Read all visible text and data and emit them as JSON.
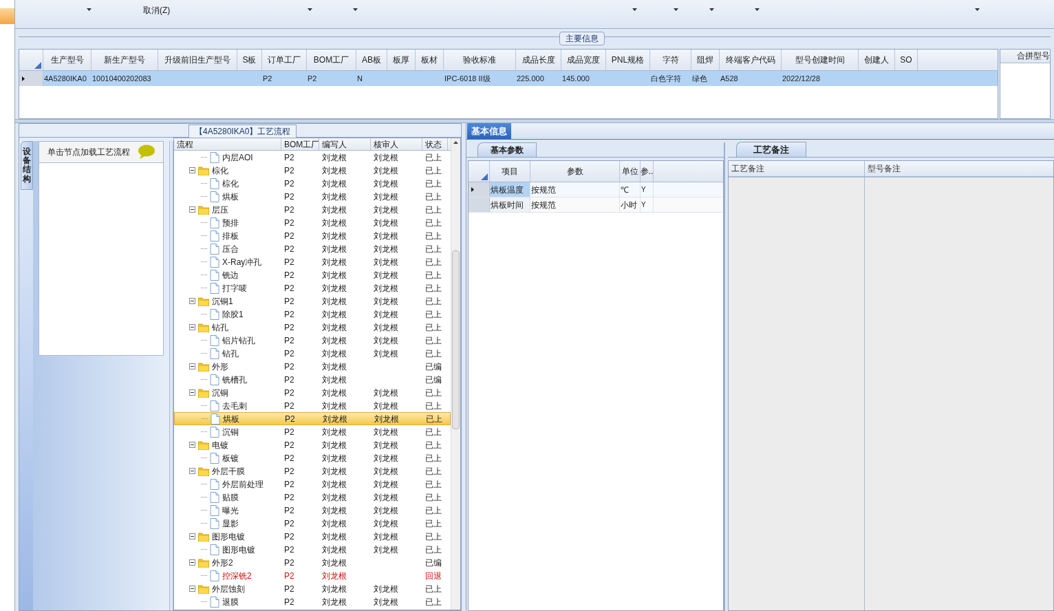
{
  "toolbar": {
    "cancel_label": "取消(Z)"
  },
  "main_info": {
    "title": "主要信息",
    "columns": [
      "生产型号",
      "新生产型号",
      "升级前旧生产型号",
      "S板",
      "订单工厂",
      "BOM工厂",
      "AB板",
      "板厚",
      "板材",
      "验收标准",
      "成品长度",
      "成品宽度",
      "PNL规格",
      "字符",
      "阻焊",
      "终端客户代码",
      "型号创建时间",
      "创建人",
      "SO"
    ],
    "rows": [
      {
        "selected": true,
        "cells": [
          "4A5280IKA0",
          "10010400202083",
          "",
          "",
          "P2",
          "P2",
          "N",
          "",
          "",
          "IPC-6018 II级",
          "225.000",
          "145.000",
          "",
          "白色字符",
          "绿色",
          "A528",
          "2022/12/28",
          "",
          ""
        ]
      }
    ],
    "side_column": "合拼型号"
  },
  "flow_panel": {
    "title": "【4A5280IKA0】工艺流程",
    "side_tab": "设备结构",
    "hint": "单击节点加载工艺流程",
    "columns": [
      "流程",
      "BOM工厂",
      "编写人",
      "核审人",
      "状态"
    ],
    "continued_children": [
      {
        "name": "内层AOI",
        "bom": "P2",
        "writer": "刘龙根",
        "reviewer": "刘龙根",
        "status": "已上",
        "selected": false,
        "returned": false
      }
    ],
    "nodes": [
      {
        "name": "棕化",
        "bom": "P2",
        "writer": "刘龙根",
        "reviewer": "刘龙根",
        "status": "已上",
        "selected": false,
        "returned": false,
        "expanded": true,
        "children": [
          {
            "name": "棕化",
            "bom": "P2",
            "writer": "刘龙根",
            "reviewer": "刘龙根",
            "status": "已上",
            "selected": false,
            "returned": false
          },
          {
            "name": "烘板",
            "bom": "P2",
            "writer": "刘龙根",
            "reviewer": "刘龙根",
            "status": "已上",
            "selected": false,
            "returned": false
          }
        ]
      },
      {
        "name": "层压",
        "bom": "P2",
        "writer": "刘龙根",
        "reviewer": "刘龙根",
        "status": "已上",
        "selected": false,
        "returned": false,
        "expanded": true,
        "children": [
          {
            "name": "预排",
            "bom": "P2",
            "writer": "刘龙根",
            "reviewer": "刘龙根",
            "status": "已上",
            "selected": false,
            "returned": false
          },
          {
            "name": "排板",
            "bom": "P2",
            "writer": "刘龙根",
            "reviewer": "刘龙根",
            "status": "已上",
            "selected": false,
            "returned": false
          },
          {
            "name": "压合",
            "bom": "P2",
            "writer": "刘龙根",
            "reviewer": "刘龙根",
            "status": "已上",
            "selected": false,
            "returned": false
          },
          {
            "name": "X-Ray冲孔",
            "bom": "P2",
            "writer": "刘龙根",
            "reviewer": "刘龙根",
            "status": "已上",
            "selected": false,
            "returned": false
          },
          {
            "name": "铣边",
            "bom": "P2",
            "writer": "刘龙根",
            "reviewer": "刘龙根",
            "status": "已上",
            "selected": false,
            "returned": false
          },
          {
            "name": "打字唛",
            "bom": "P2",
            "writer": "刘龙根",
            "reviewer": "刘龙根",
            "status": "已上",
            "selected": false,
            "returned": false
          }
        ]
      },
      {
        "name": "沉铜1",
        "bom": "P2",
        "writer": "刘龙根",
        "reviewer": "刘龙根",
        "status": "已上",
        "selected": false,
        "returned": false,
        "expanded": true,
        "children": [
          {
            "name": "除胶1",
            "bom": "P2",
            "writer": "刘龙根",
            "reviewer": "刘龙根",
            "status": "已上",
            "selected": false,
            "returned": false
          }
        ]
      },
      {
        "name": "钻孔",
        "bom": "P2",
        "writer": "刘龙根",
        "reviewer": "刘龙根",
        "status": "已上",
        "selected": false,
        "returned": false,
        "expanded": true,
        "children": [
          {
            "name": "铝片钻孔",
            "bom": "P2",
            "writer": "刘龙根",
            "reviewer": "刘龙根",
            "status": "已上",
            "selected": false,
            "returned": false
          },
          {
            "name": "钻孔",
            "bom": "P2",
            "writer": "刘龙根",
            "reviewer": "刘龙根",
            "status": "已上",
            "selected": false,
            "returned": false
          }
        ]
      },
      {
        "name": "外形",
        "bom": "P2",
        "writer": "刘龙根",
        "status": "已编",
        "selected": false,
        "returned": false,
        "expanded": true,
        "children": [
          {
            "name": "铣槽孔",
            "bom": "P2",
            "writer": "刘龙根",
            "status": "已编",
            "selected": false,
            "returned": false
          }
        ]
      },
      {
        "name": "沉铜",
        "bom": "P2",
        "writer": "刘龙根",
        "reviewer": "刘龙根",
        "status": "已上",
        "selected": false,
        "returned": false,
        "expanded": true,
        "children": [
          {
            "name": "去毛刺",
            "bom": "P2",
            "writer": "刘龙根",
            "reviewer": "刘龙根",
            "status": "已上",
            "selected": false,
            "returned": false
          },
          {
            "name": "烘板",
            "bom": "P2",
            "writer": "刘龙根",
            "reviewer": "刘龙根",
            "status": "已上",
            "selected": true,
            "returned": false
          },
          {
            "name": "沉铜",
            "bom": "P2",
            "writer": "刘龙根",
            "reviewer": "刘龙根",
            "status": "已上",
            "selected": false,
            "returned": false
          }
        ]
      },
      {
        "name": "电镀",
        "bom": "P2",
        "writer": "刘龙根",
        "reviewer": "刘龙根",
        "status": "已上",
        "selected": false,
        "returned": false,
        "expanded": true,
        "children": [
          {
            "name": "板镀",
            "bom": "P2",
            "writer": "刘龙根",
            "reviewer": "刘龙根",
            "status": "已上",
            "selected": false,
            "returned": false
          }
        ]
      },
      {
        "name": "外层干膜",
        "bom": "P2",
        "writer": "刘龙根",
        "reviewer": "刘龙根",
        "status": "已上",
        "selected": false,
        "returned": false,
        "expanded": true,
        "children": [
          {
            "name": "外层前处理",
            "bom": "P2",
            "writer": "刘龙根",
            "reviewer": "刘龙根",
            "status": "已上",
            "selected": false,
            "returned": false
          },
          {
            "name": "贴膜",
            "bom": "P2",
            "writer": "刘龙根",
            "reviewer": "刘龙根",
            "status": "已上",
            "selected": false,
            "returned": false
          },
          {
            "name": "曝光",
            "bom": "P2",
            "writer": "刘龙根",
            "reviewer": "刘龙根",
            "status": "已上",
            "selected": false,
            "returned": false
          },
          {
            "name": "显影",
            "bom": "P2",
            "writer": "刘龙根",
            "reviewer": "刘龙根",
            "status": "已上",
            "selected": false,
            "returned": false
          }
        ]
      },
      {
        "name": "图形电镀",
        "bom": "P2",
        "writer": "刘龙根",
        "reviewer": "刘龙根",
        "status": "已上",
        "selected": false,
        "returned": false,
        "expanded": true,
        "children": [
          {
            "name": "图形电镀",
            "bom": "P2",
            "writer": "刘龙根",
            "reviewer": "刘龙根",
            "status": "已上",
            "selected": false,
            "returned": false
          }
        ]
      },
      {
        "name": "外形2",
        "bom": "P2",
        "writer": "刘龙根",
        "status": "已编",
        "selected": false,
        "returned": false,
        "expanded": true,
        "children": [
          {
            "name": "控深铣2",
            "bom": "P2",
            "writer": "刘龙根",
            "status": "回退",
            "selected": false,
            "returned": true
          }
        ]
      },
      {
        "name": "外层蚀刻",
        "bom": "P2",
        "writer": "刘龙根",
        "reviewer": "刘龙根",
        "status": "已上",
        "selected": false,
        "returned": false,
        "expanded": true,
        "children": [
          {
            "name": "退膜",
            "bom": "P2",
            "writer": "刘龙根",
            "reviewer": "刘龙根",
            "status": "已上",
            "selected": false,
            "returned": false
          }
        ]
      }
    ]
  },
  "basic_info": {
    "tab": "基本信息",
    "sub_tab": "基本参数",
    "columns": [
      "项目",
      "参数",
      "单位",
      "参.."
    ],
    "rows": [
      {
        "selected": true,
        "cells": [
          "烘板温度",
          "按规范",
          "℃",
          "Y"
        ]
      },
      {
        "selected": false,
        "cells": [
          "烘板时间",
          "按规范",
          "小时",
          "Y"
        ]
      }
    ]
  },
  "remarks": {
    "tab": "工艺备注",
    "columns": [
      "工艺备注",
      "型号备注"
    ]
  }
}
